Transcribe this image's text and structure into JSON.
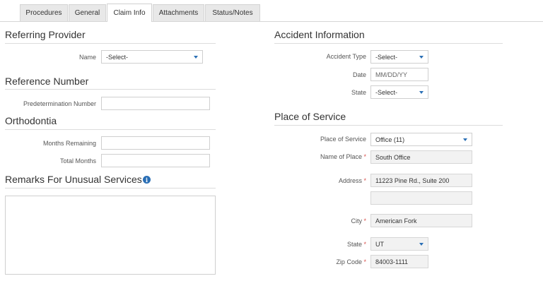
{
  "tabs": [
    {
      "label": "Procedures"
    },
    {
      "label": "General"
    },
    {
      "label": "Claim Info"
    },
    {
      "label": "Attachments"
    },
    {
      "label": "Status/Notes"
    }
  ],
  "active_tab": "Claim Info",
  "referring_provider": {
    "title": "Referring Provider",
    "name_label": "Name",
    "name_value": "-Select-"
  },
  "reference_number": {
    "title": "Reference Number",
    "predetermination_label": "Predetermination Number",
    "predetermination_value": ""
  },
  "orthodontia": {
    "title": "Orthodontia",
    "months_remaining_label": "Months Remaining",
    "months_remaining_value": "",
    "total_months_label": "Total Months",
    "total_months_value": ""
  },
  "remarks": {
    "title": "Remarks For Unusual Services",
    "info_icon": "i",
    "value": ""
  },
  "accident": {
    "title": "Accident Information",
    "type_label": "Accident Type",
    "type_value": "-Select-",
    "date_label": "Date",
    "date_placeholder": "MM/DD/YY",
    "state_label": "State",
    "state_value": "-Select-"
  },
  "place_of_service": {
    "title": "Place of Service",
    "place_label": "Place of Service",
    "place_value": "Office (11)",
    "name_label": "Name of Place",
    "name_value": "South Office",
    "address_label": "Address",
    "address1_value": "11223 Pine Rd., Suite 200",
    "address2_value": "",
    "city_label": "City",
    "city_value": "American Fork",
    "state_label": "State",
    "state_value": "UT",
    "zip_label": "Zip Code",
    "zip_value": "84003-1111",
    "required_marker": "*"
  },
  "colors": {
    "accent": "#2a6fb5",
    "required": "#d9534f"
  }
}
